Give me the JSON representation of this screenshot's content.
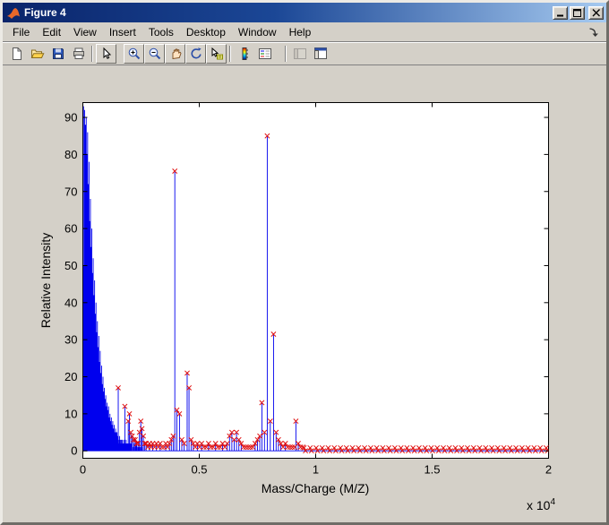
{
  "window": {
    "title": "Figure 4",
    "control_buttons": [
      "minimize",
      "maximize",
      "close"
    ]
  },
  "menu_bar": {
    "items": [
      "File",
      "Edit",
      "View",
      "Insert",
      "Tools",
      "Desktop",
      "Window",
      "Help"
    ],
    "dock_arrow_icon": "dock-figure-arrow"
  },
  "toolbar": {
    "buttons": [
      "new-figure",
      "open-file",
      "save-figure",
      "print-figure",
      "edit-plot",
      "zoom-in",
      "zoom-out",
      "pan",
      "rotate-3d",
      "data-cursor",
      "insert-colorbar",
      "insert-legend",
      "hide-plot-tools",
      "show-plot-tools-dock"
    ]
  },
  "chart_data": {
    "type": "line",
    "title": "",
    "xlabel": "Mass/Charge (M/Z)",
    "ylabel": "Relative Intensity",
    "x_multiplier": {
      "base": "x 10",
      "exponent": "4"
    },
    "xlim": [
      0,
      20000
    ],
    "ylim": [
      -2,
      94
    ],
    "grid": false,
    "background": "#ffffff",
    "x_ticks": {
      "values": [
        0,
        5000,
        10000,
        15000,
        20000
      ],
      "labels": [
        "0",
        "0.5",
        "1",
        "1.5",
        "2"
      ]
    },
    "y_ticks": {
      "values": [
        0,
        10,
        20,
        30,
        40,
        50,
        60,
        70,
        80,
        90
      ],
      "labels": [
        "0",
        "10",
        "20",
        "30",
        "40",
        "50",
        "60",
        "70",
        "80",
        "90"
      ]
    },
    "series": [
      {
        "name": "spectrum",
        "type": "line",
        "color": "#0000ee",
        "spikes": [
          [
            30,
            93
          ],
          [
            55,
            50
          ],
          [
            75,
            92
          ],
          [
            95,
            38
          ],
          [
            110,
            88
          ],
          [
            130,
            55
          ],
          [
            145,
            90
          ],
          [
            160,
            42
          ],
          [
            175,
            80
          ],
          [
            190,
            60
          ],
          [
            205,
            86
          ],
          [
            220,
            35
          ],
          [
            235,
            72
          ],
          [
            250,
            52
          ],
          [
            265,
            78
          ],
          [
            280,
            30
          ],
          [
            295,
            62
          ],
          [
            310,
            45
          ],
          [
            325,
            68
          ],
          [
            340,
            26
          ],
          [
            355,
            55
          ],
          [
            370,
            40
          ],
          [
            385,
            60
          ],
          [
            400,
            22
          ],
          [
            415,
            48
          ],
          [
            430,
            34
          ],
          [
            445,
            52
          ],
          [
            460,
            19
          ],
          [
            475,
            42
          ],
          [
            490,
            30
          ],
          [
            505,
            46
          ],
          [
            520,
            17
          ],
          [
            535,
            37
          ],
          [
            550,
            26
          ],
          [
            565,
            40
          ],
          [
            580,
            15
          ],
          [
            595,
            32
          ],
          [
            610,
            23
          ],
          [
            625,
            35
          ],
          [
            640,
            13
          ],
          [
            655,
            28
          ],
          [
            670,
            20
          ],
          [
            685,
            31
          ],
          [
            700,
            11
          ],
          [
            715,
            24
          ],
          [
            730,
            17
          ],
          [
            745,
            27
          ],
          [
            760,
            10
          ],
          [
            775,
            21
          ],
          [
            790,
            15
          ],
          [
            805,
            23
          ],
          [
            820,
            9
          ],
          [
            835,
            18
          ],
          [
            850,
            13
          ],
          [
            865,
            20
          ],
          [
            880,
            8
          ],
          [
            895,
            16
          ],
          [
            910,
            11
          ],
          [
            925,
            17
          ],
          [
            940,
            7
          ],
          [
            955,
            14
          ],
          [
            970,
            10
          ],
          [
            985,
            15
          ],
          [
            1000,
            6
          ],
          [
            1015,
            12
          ],
          [
            1030,
            9
          ],
          [
            1045,
            13
          ],
          [
            1060,
            5
          ],
          [
            1075,
            11
          ],
          [
            1090,
            8
          ],
          [
            1105,
            12
          ],
          [
            1120,
            5
          ],
          [
            1135,
            9
          ],
          [
            1150,
            7
          ],
          [
            1165,
            10
          ],
          [
            1180,
            4
          ],
          [
            1195,
            8
          ],
          [
            1210,
            6
          ],
          [
            1225,
            9
          ],
          [
            1240,
            4
          ],
          [
            1255,
            7
          ],
          [
            1270,
            5
          ],
          [
            1285,
            8
          ],
          [
            1300,
            3
          ],
          [
            1315,
            6
          ],
          [
            1330,
            5
          ],
          [
            1345,
            7
          ],
          [
            1360,
            3
          ],
          [
            1375,
            5
          ],
          [
            1390,
            4
          ],
          [
            1405,
            6
          ],
          [
            1420,
            3
          ],
          [
            1435,
            5
          ],
          [
            1450,
            4
          ],
          [
            1465,
            5
          ],
          [
            1480,
            2
          ],
          [
            1495,
            4
          ],
          [
            1510,
            3
          ],
          [
            1540,
            2
          ],
          [
            1560,
            3
          ],
          [
            1580,
            4
          ],
          [
            1600,
            2
          ],
          [
            1620,
            3
          ],
          [
            1640,
            2
          ],
          [
            1660,
            3
          ],
          [
            1680,
            2
          ],
          [
            1700,
            3
          ],
          [
            1720,
            2
          ],
          [
            1740,
            2
          ],
          [
            1760,
            3
          ],
          [
            1780,
            2
          ],
          [
            1800,
            2
          ],
          [
            1820,
            2
          ],
          [
            1840,
            2
          ],
          [
            1860,
            3
          ],
          [
            1880,
            2
          ],
          [
            1900,
            2
          ],
          [
            1920,
            2
          ],
          [
            1940,
            2
          ],
          [
            1960,
            2
          ],
          [
            1980,
            2
          ],
          [
            2020,
            2
          ],
          [
            2040,
            2
          ],
          [
            2080,
            2
          ],
          [
            2120,
            2
          ],
          [
            2160,
            1
          ],
          [
            2200,
            2
          ],
          [
            2240,
            1
          ],
          [
            2280,
            2
          ],
          [
            2320,
            1
          ],
          [
            2360,
            1
          ],
          [
            2400,
            1
          ],
          [
            2450,
            1
          ],
          [
            2500,
            1
          ],
          [
            2550,
            1
          ],
          [
            2600,
            1
          ]
        ]
      },
      {
        "name": "detected-peaks",
        "type": "scatter",
        "marker": "x",
        "color": "#e01010",
        "points": [
          [
            1520,
            17
          ],
          [
            1805,
            12
          ],
          [
            1950,
            8
          ],
          [
            2000,
            10
          ],
          [
            2060,
            5
          ],
          [
            2120,
            4
          ],
          [
            2180,
            3
          ],
          [
            2250,
            3
          ],
          [
            2310,
            2
          ],
          [
            2370,
            2
          ],
          [
            2430,
            5
          ],
          [
            2490,
            8
          ],
          [
            2540,
            6
          ],
          [
            2600,
            4
          ],
          [
            2660,
            2
          ],
          [
            2720,
            2
          ],
          [
            2790,
            1
          ],
          [
            2860,
            2
          ],
          [
            2930,
            1
          ],
          [
            3000,
            2
          ],
          [
            3080,
            1
          ],
          [
            3160,
            2
          ],
          [
            3240,
            1
          ],
          [
            3320,
            2
          ],
          [
            3400,
            1
          ],
          [
            3480,
            1
          ],
          [
            3560,
            2
          ],
          [
            3640,
            1
          ],
          [
            3720,
            2
          ],
          [
            3800,
            3
          ],
          [
            3880,
            4
          ],
          [
            3950,
            75.5
          ],
          [
            4040,
            11
          ],
          [
            4150,
            10
          ],
          [
            4250,
            3
          ],
          [
            4350,
            2
          ],
          [
            4480,
            21
          ],
          [
            4560,
            17
          ],
          [
            4650,
            3
          ],
          [
            4740,
            2
          ],
          [
            4830,
            1
          ],
          [
            4920,
            2
          ],
          [
            5010,
            1
          ],
          [
            5100,
            2
          ],
          [
            5200,
            1
          ],
          [
            5300,
            1
          ],
          [
            5400,
            2
          ],
          [
            5500,
            1
          ],
          [
            5600,
            1
          ],
          [
            5700,
            2
          ],
          [
            5800,
            1
          ],
          [
            5900,
            1
          ],
          [
            6000,
            2
          ],
          [
            6100,
            1
          ],
          [
            6200,
            2
          ],
          [
            6300,
            4
          ],
          [
            6400,
            5
          ],
          [
            6500,
            3
          ],
          [
            6600,
            5
          ],
          [
            6700,
            3
          ],
          [
            6800,
            2
          ],
          [
            6900,
            1
          ],
          [
            7000,
            1
          ],
          [
            7100,
            1
          ],
          [
            7200,
            1
          ],
          [
            7300,
            1
          ],
          [
            7400,
            2
          ],
          [
            7500,
            3
          ],
          [
            7600,
            4
          ],
          [
            7690,
            13
          ],
          [
            7800,
            5
          ],
          [
            7920,
            85
          ],
          [
            8050,
            8
          ],
          [
            8190,
            31.5
          ],
          [
            8300,
            5
          ],
          [
            8400,
            3
          ],
          [
            8500,
            2
          ],
          [
            8600,
            1
          ],
          [
            8700,
            2
          ],
          [
            8800,
            1
          ],
          [
            8900,
            1
          ],
          [
            9000,
            1
          ],
          [
            9100,
            1
          ],
          [
            9150,
            8
          ],
          [
            9250,
            2
          ],
          [
            9350,
            1
          ],
          [
            9450,
            1
          ]
        ],
        "baseline_runs": [
          {
            "from": 9500,
            "to": 20000,
            "step": 260,
            "y": 0.8
          },
          {
            "from": 9560,
            "to": 20000,
            "step": 260,
            "y": 0
          }
        ]
      }
    ]
  }
}
